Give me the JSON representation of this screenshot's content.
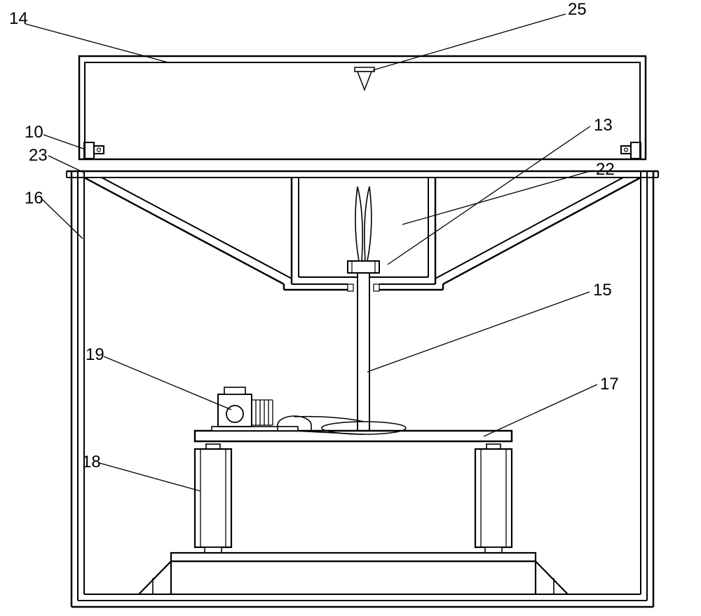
{
  "labels": {
    "l14": "14",
    "l25": "25",
    "l10": "10",
    "l13": "13",
    "l23": "23",
    "l22": "22",
    "l16": "16",
    "l15": "15",
    "l19": "19",
    "l17": "17",
    "l18": "18"
  }
}
